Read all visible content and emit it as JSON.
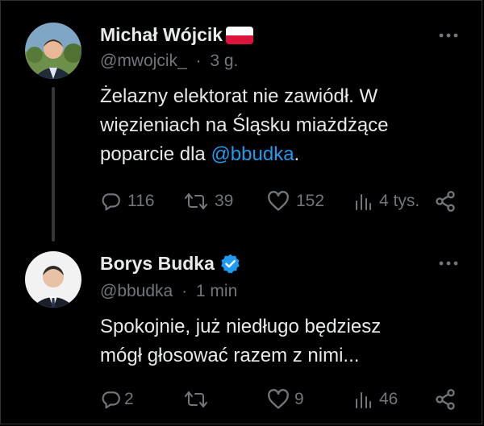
{
  "tweets": [
    {
      "author": "Michał Wójcik",
      "handle": "@mwojcik_",
      "separator": "·",
      "time": "3 g.",
      "text_before": "Żelazny elektorat nie zawiódł. W więzieniach na Śląsku miażdżące poparcie dla ",
      "mention": "@bbudka",
      "text_after": ".",
      "replies": "116",
      "retweets": "39",
      "likes": "152",
      "views": "4 tys.",
      "badge_icon": "poland-flag-icon"
    },
    {
      "author": "Borys Budka",
      "handle": "@bbudka",
      "separator": "·",
      "time": "1 min",
      "text": "Spokojnie, już niedługo będziesz mógł głosować razem z nimi...",
      "replies": "2",
      "retweets": "",
      "likes": "9",
      "views": "46",
      "badge_icon": "verified-badge-icon"
    }
  ],
  "colors": {
    "background": "#000000",
    "text": "#e7e9ea",
    "muted": "#71767b",
    "link": "#1d9bf0",
    "verified": "#1d9bf0"
  }
}
